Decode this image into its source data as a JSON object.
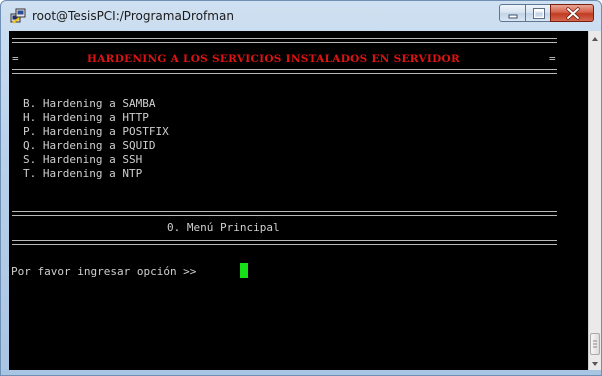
{
  "window": {
    "title": "root@TesisPCI:/ProgramaDrofman"
  },
  "icons": {
    "app": "putty-icon",
    "minimize": "minimize-icon",
    "maximize": "maximize-icon",
    "close": "close-icon",
    "scroll_up": "scroll-up-arrow-icon",
    "scroll_down": "scroll-down-arrow-icon"
  },
  "terminal": {
    "header_left_marker": "=",
    "header_title": "HARDENING A LOS SERVICIOS INSTALADOS EN SERVIDOR",
    "header_right_marker": "=",
    "items": [
      {
        "label": "B. Hardening a SAMBA"
      },
      {
        "label": "H. Hardening a HTTP"
      },
      {
        "label": "P. Hardening a POSTFIX"
      },
      {
        "label": "Q. Hardening a SQUID"
      },
      {
        "label": "S. Hardening a SSH"
      },
      {
        "label": "T. Hardening a NTP"
      }
    ],
    "main_menu": "0. Menú Principal",
    "prompt": "Por favor ingresar opción >>"
  },
  "colors": {
    "terminal_bg": "#000000",
    "terminal_text": "#cfcfcf",
    "header_text": "#e01212",
    "cursor": "#18e018"
  }
}
